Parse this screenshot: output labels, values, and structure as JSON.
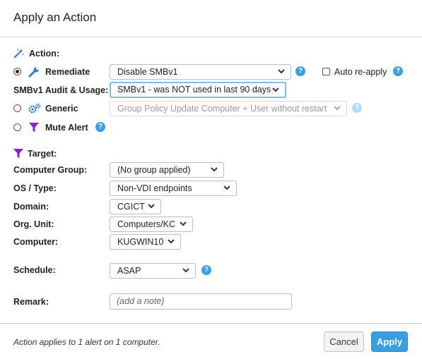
{
  "dialog": {
    "title": "Apply an Action"
  },
  "action_section": {
    "header": "Action:",
    "remediate": {
      "label": "Remediate",
      "selected": true,
      "select_value": "Disable SMBv1",
      "auto_reapply_label": "Auto re-apply",
      "auto_reapply_checked": false
    },
    "smb_audit": {
      "label": "SMBv1 Audit & Usage:",
      "select_value": "SMBv1 - was NOT used in last 90 days"
    },
    "generic": {
      "label": "Generic",
      "selected": false,
      "select_value": "Group Policy Update Computer + User without restart"
    },
    "mute_alert": {
      "label": "Mute Alert",
      "selected": false
    }
  },
  "target_section": {
    "header": "Target:",
    "computer_group": {
      "label": "Computer Group:",
      "value": "(No group applied)"
    },
    "os_type": {
      "label": "OS / Type:",
      "value": "Non-VDI endpoints"
    },
    "domain": {
      "label": "Domain:",
      "value": "CGICT"
    },
    "org_unit": {
      "label": "Org. Unit:",
      "value": "Computers/KC"
    },
    "computer": {
      "label": "Computer:",
      "value": "KUGWIN10"
    }
  },
  "schedule": {
    "label": "Schedule:",
    "value": "ASAP"
  },
  "remark": {
    "label": "Remark:",
    "placeholder": "(add a note)"
  },
  "footer": {
    "summary": "Action applies to 1 alert on 1 computer.",
    "cancel_label": "Cancel",
    "apply_label": "Apply"
  },
  "colors": {
    "accent_blue": "#3a9de0",
    "help_icon": "#3b9fe0",
    "filter_icon": "#8a1fc9",
    "focus_border": "#7dbce8"
  },
  "icons": {
    "action_header": "magic-wand-icon",
    "remediate": "wrench-icon",
    "generic": "gears-icon",
    "mute_alert": "filter-icon",
    "target_header": "filter-icon",
    "help": "help-icon",
    "dropdown": "chevron-down-icon"
  }
}
